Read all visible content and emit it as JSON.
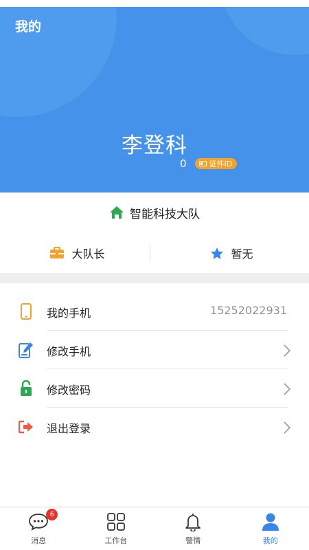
{
  "header": {
    "title": "我的",
    "user_name": "李登科",
    "id_count": "0",
    "id_badge": "证件ID",
    "bg_color": "#4592ea",
    "badge_color": "#f3a22b"
  },
  "team": {
    "name": "智能科技大队",
    "icon": "home-icon",
    "icon_color": "#2fa853"
  },
  "roles": [
    {
      "label": "大队长",
      "icon": "briefcase-icon",
      "color": "#f3a22b"
    },
    {
      "label": "暂无",
      "icon": "star-icon",
      "color": "#3a86e8"
    }
  ],
  "menu": [
    {
      "label": "我的手机",
      "value": "15252022931",
      "icon": "phone-icon",
      "color": "#f3a22b"
    },
    {
      "label": "修改手机",
      "icon": "edit-phone-icon",
      "color": "#3a86e8"
    },
    {
      "label": "修改密码",
      "icon": "unlock-icon",
      "color": "#2fa853"
    },
    {
      "label": "退出登录",
      "icon": "logout-icon",
      "color": "#ef5a48"
    }
  ],
  "tabbar": {
    "items": [
      {
        "label": "消息",
        "icon": "chat-icon",
        "badge": "6"
      },
      {
        "label": "工作台",
        "icon": "grid-icon"
      },
      {
        "label": "警情",
        "icon": "bell-icon"
      },
      {
        "label": "我的",
        "icon": "user-icon",
        "active": true
      }
    ],
    "active_color": "#3a86e8",
    "badge_color": "#e8322f"
  }
}
